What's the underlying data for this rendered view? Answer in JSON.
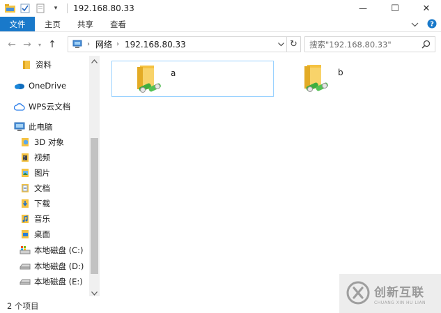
{
  "window": {
    "title": "192.168.80.33",
    "controls": {
      "minimize": "—",
      "maximize": "☐",
      "close": "✕"
    }
  },
  "ribbon": {
    "tabs": [
      "文件",
      "主页",
      "共享",
      "查看"
    ]
  },
  "address": {
    "root": "网络",
    "current": "192.168.80.33"
  },
  "search": {
    "placeholder": "搜索\"192.168.80.33\""
  },
  "nav": {
    "items": [
      {
        "label": "资料",
        "icon": "folder-icon"
      },
      {
        "label": "OneDrive",
        "icon": "onedrive-cloud-icon"
      },
      {
        "label": "WPS云文档",
        "icon": "wps-cloud-icon"
      },
      {
        "label": "此电脑",
        "icon": "this-pc-icon"
      },
      {
        "label": "3D 对象",
        "icon": "3d-objects-icon"
      },
      {
        "label": "视频",
        "icon": "videos-icon"
      },
      {
        "label": "图片",
        "icon": "pictures-icon"
      },
      {
        "label": "文档",
        "icon": "documents-icon"
      },
      {
        "label": "下载",
        "icon": "downloads-icon"
      },
      {
        "label": "音乐",
        "icon": "music-icon"
      },
      {
        "label": "桌面",
        "icon": "desktop-icon"
      },
      {
        "label": "本地磁盘 (C:)",
        "icon": "system-drive-icon"
      },
      {
        "label": "本地磁盘 (D:)",
        "icon": "drive-icon"
      },
      {
        "label": "本地磁盘 (E:)",
        "icon": "drive-icon"
      }
    ]
  },
  "content": {
    "items": [
      {
        "name": "a",
        "selected": true
      },
      {
        "name": "b",
        "selected": false
      }
    ]
  },
  "status": {
    "text": "2 个项目"
  },
  "watermark": {
    "cn": "创新互联",
    "en": "CHUANG XIN HU LIAN"
  },
  "colors": {
    "accent": "#1979ca",
    "selection_border": "#99d1ff",
    "folder": "#f5c242",
    "share_green": "#3fae3f"
  }
}
